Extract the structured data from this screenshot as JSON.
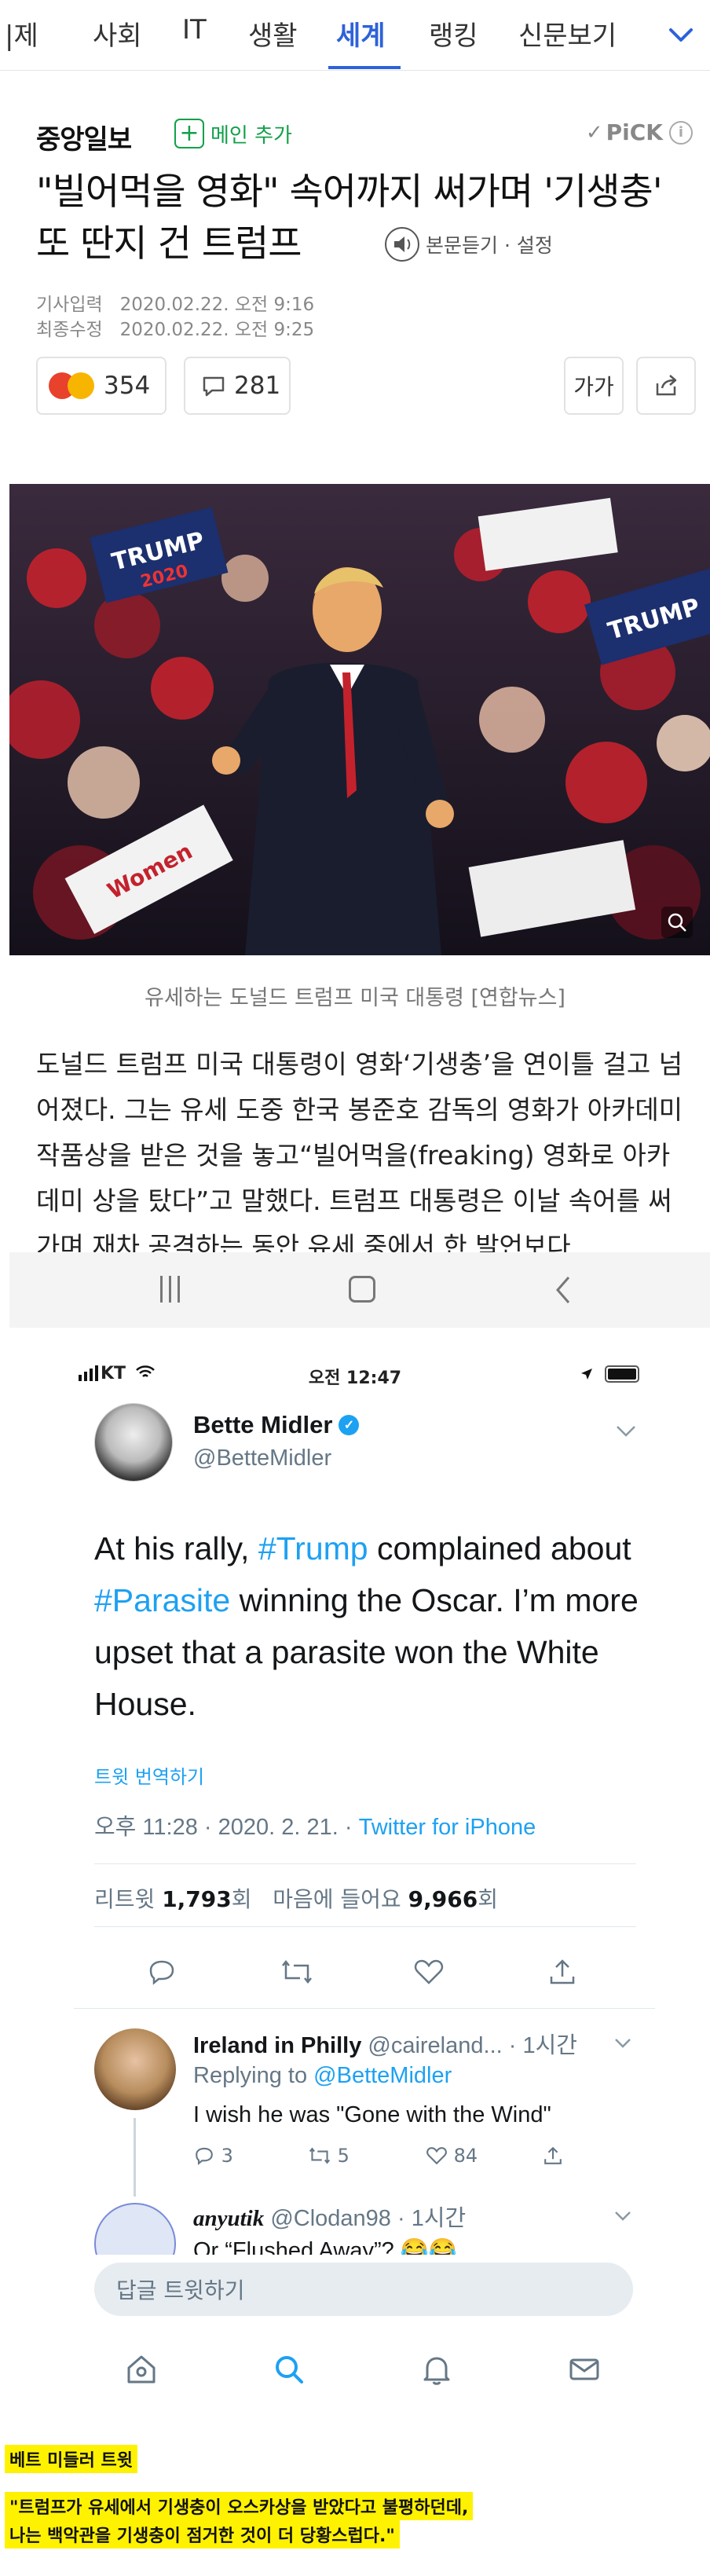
{
  "nav": {
    "tabs": [
      "|제",
      "사회",
      "IT",
      "생활",
      "세계",
      "랭킹",
      "신문보기"
    ],
    "active_tab": "세계"
  },
  "article": {
    "press": "중앙일보",
    "subscribe_label": "메인 추가",
    "pick_label": "PiCK",
    "headline": "\"빌어먹을 영화\" 속어까지 써가며 '기생충' 또 딴지 건 트럼프",
    "listen_label": "본문듣기 · 설정",
    "published_label": "기사입력",
    "published": "2020.02.22. 오전 9:16",
    "modified_label": "최종수정",
    "modified": "2020.02.22. 오전 9:25",
    "reactions": "354",
    "comments": "281",
    "font_btn": "가가",
    "caption": "유세하는 도널드 트럼프 미국 대통령 [연합뉴스]",
    "body": "도널드 트럼프 미국 대통령이 영화‘기생충’을 연이틀 걸고 넘어졌다. 그는 유세 도중 한국 봉준호 감독의 영화가 아카데미 작품상을 받은 것을 놓고“빌어먹을(freaking) 영화로 아카데미 상을 탔다”고 말했다. 트럼프 대통령은 이날 속어를 써가며 재차 공격하는 동안 유세 중에서 한 발언보다"
  },
  "photo": {
    "sign_text_1": "TRUMP",
    "sign_text_2": "2020",
    "sign_text_3": "Women"
  },
  "twitter": {
    "carrier": "KT",
    "time": "오전 12:47",
    "author_name": "Bette Midler",
    "author_handle": "@BetteMidler",
    "tweet_parts": [
      "At his rally, ",
      "#Trump",
      " complained about ",
      "#Parasite",
      " winning the Oscar. I’m more upset that a parasite won the White House."
    ],
    "translate_label": "트윗 번역하기",
    "timestamp": "오후 11:28 · 2020. 2. 21. · ",
    "source": "Twitter for iPhone",
    "retweets_label": "리트윗",
    "retweets": "1,793",
    "count_unit": "회",
    "likes_label": "마음에 들어요",
    "likes": "9,966",
    "reply1": {
      "name": "Ireland in Philly",
      "handle": "@caireland...",
      "time": "· 1시간",
      "replying_label": "Replying to ",
      "replying_to": "@BetteMidler",
      "text": "I wish he was \"Gone with the Wind\"",
      "replies": "3",
      "retweets": "5",
      "likes": "84"
    },
    "reply2": {
      "name": "anyutik",
      "handle": "@Clodan98",
      "time": "· 1시간",
      "text": "Or “Flushed Away”? 😂😂"
    },
    "reply_placeholder": "답글 트윗하기"
  },
  "overlay": {
    "title": "베트 미들러 트윗",
    "line1": "\"트럼프가 유세에서 기생충이 오스카상을 받았다고 불평하던데,",
    "line2": "나는 백악관을 기생충이 점거한 것이 더 당황스럽다.\""
  },
  "colors": {
    "naver_blue": "#2d62d9",
    "naver_green": "#13a04a",
    "twitter_blue": "#1da1f2",
    "highlight": "#fff200"
  }
}
